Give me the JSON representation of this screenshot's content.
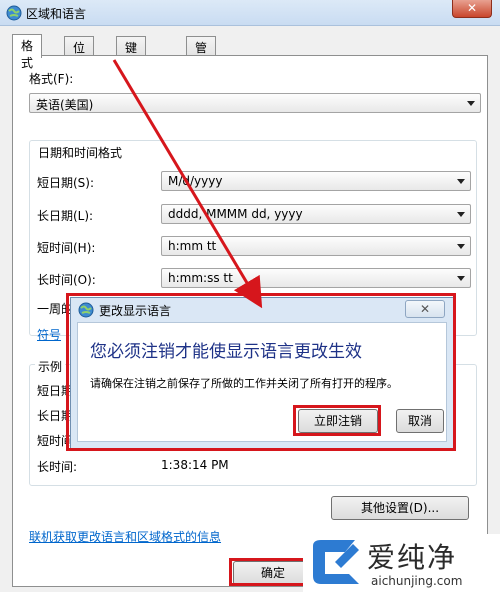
{
  "window": {
    "title": "区域和语言",
    "close_symbol": "✕"
  },
  "tabs": [
    {
      "label": "格式",
      "active": true
    },
    {
      "label": "位置",
      "active": false
    },
    {
      "label": "键盘和语言",
      "active": false
    },
    {
      "label": "管理",
      "active": false
    }
  ],
  "format": {
    "label": "格式(F):",
    "value": "英语(美国)"
  },
  "datetime_group": {
    "title": "日期和时间格式",
    "short_date": {
      "label": "短日期(S):",
      "value": "M/d/yyyy"
    },
    "long_date": {
      "label": "长日期(L):",
      "value": "dddd, MMMM dd, yyyy"
    },
    "short_time": {
      "label": "短时间(H):",
      "value": "h:mm tt"
    },
    "long_time": {
      "label": "长时间(O):",
      "value": "h:mm:ss tt"
    },
    "first_day_label": "一周的",
    "symbol_link": "符号"
  },
  "examples": {
    "title": "示例",
    "short_date_label": "短日期",
    "long_date_label": "长日期",
    "short_time_label": "短时间",
    "long_time_label": "长时间:",
    "long_time_value": "1:38:14 PM"
  },
  "other_settings_button": "其他设置(D)...",
  "online_link": "联机获取更改语言和区域格式的信息",
  "ok_button": "确定",
  "dialog": {
    "title": "更改显示语言",
    "close_symbol": "✕",
    "heading": "您必须注销才能使显示语言更改生效",
    "message": "请确保在注销之前保存了所做的工作并关闭了所有打开的程序。",
    "logoff_button": "立即注销",
    "cancel_button": "取消"
  },
  "watermark": {
    "title": "爱纯净",
    "site": "aichunjing.com"
  },
  "colors": {
    "annotation_red": "#d6161c",
    "link_blue": "#0066cc",
    "heading_blue": "#1e3287"
  }
}
